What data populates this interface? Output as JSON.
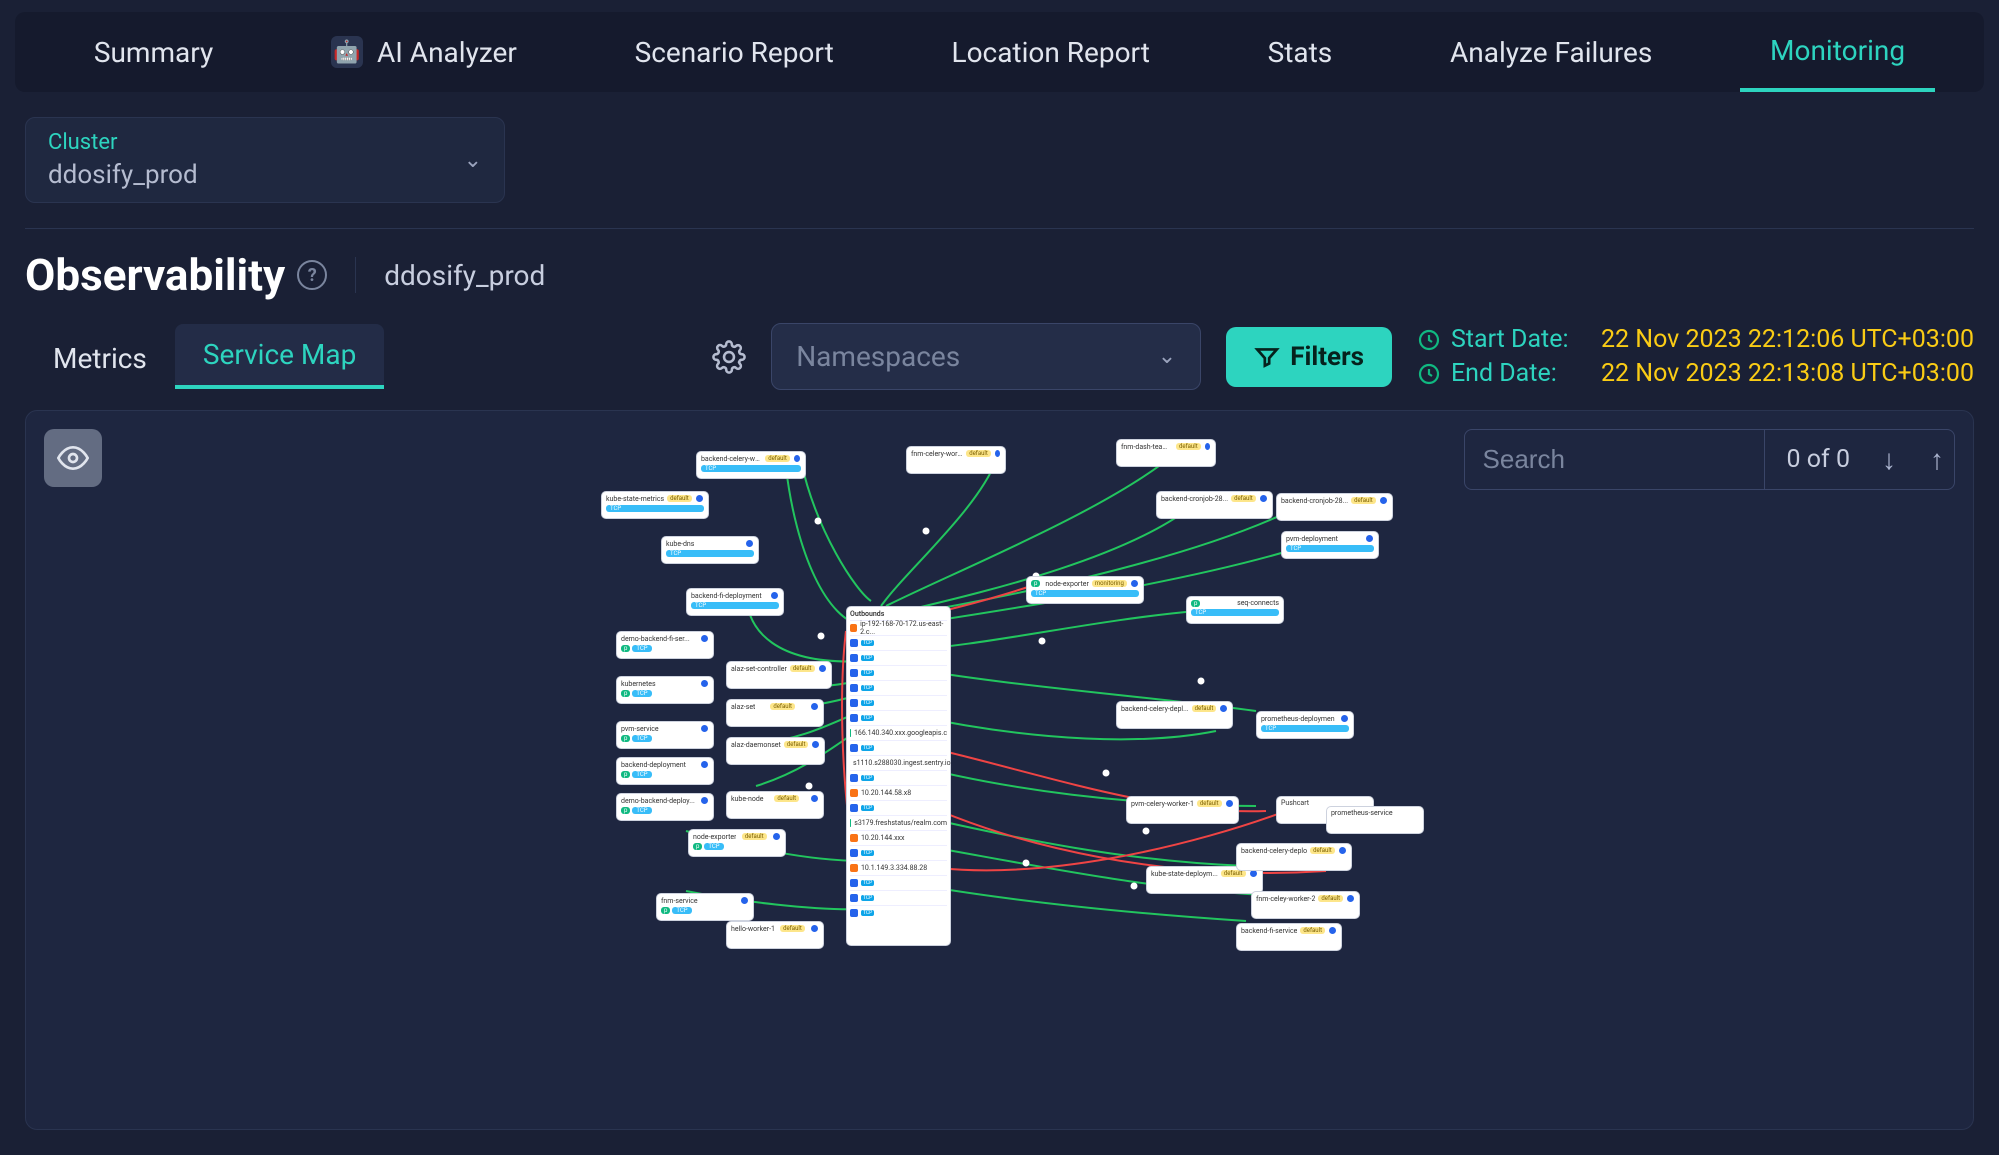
{
  "nav": {
    "tabs": [
      {
        "id": "summary",
        "label": "Summary"
      },
      {
        "id": "ai",
        "label": "AI Analyzer"
      },
      {
        "id": "scenario",
        "label": "Scenario Report"
      },
      {
        "id": "location",
        "label": "Location Report"
      },
      {
        "id": "stats",
        "label": "Stats"
      },
      {
        "id": "failures",
        "label": "Analyze Failures"
      },
      {
        "id": "monitoring",
        "label": "Monitoring"
      }
    ],
    "active_tab": "monitoring"
  },
  "cluster_selector": {
    "label": "Cluster",
    "value": "ddosify_prod"
  },
  "page": {
    "title": "Observability",
    "cluster": "ddosify_prod"
  },
  "sub_tabs": {
    "items": [
      "Metrics",
      "Service Map"
    ],
    "active": 1
  },
  "namespace_select": {
    "placeholder": "Namespaces"
  },
  "filters_btn": "Filters",
  "dates": {
    "start_label": "Start Date:",
    "start_value": "22 Nov 2023 22:12:06 UTC+03:00",
    "end_label": "End Date:",
    "end_value": "22 Nov 2023 22:13:08 UTC+03:00"
  },
  "search": {
    "placeholder": "Search",
    "count": "0 of 0"
  },
  "colors": {
    "accent": "#2dd4bf",
    "warn": "#facc15",
    "bg": "#1a2035",
    "edge_ok": "#22c55e",
    "edge_err": "#ef4444"
  },
  "graph": {
    "big_node": {
      "header": "Outbounds",
      "rows_partial": [
        "ip-192-168-70-172.us-east-2.c...",
        "TCP",
        "TCP",
        "TCP",
        "TCP",
        "TCP",
        "TCP",
        "166.140.340.xxx.googleapis.c",
        "TCP",
        "s1110.s288030.ingest.sentry.io",
        "TCP",
        "10.20.144.58.x8",
        "TCP",
        "s3179.freshstatus/realm.com",
        "10.20.144.xxx",
        "TCP",
        "10.1.149.3.334.88.28",
        "TCP",
        "TCP",
        "TCP"
      ]
    },
    "nodes_left_col1": [
      "kube-state-metrics",
      "kube-dns",
      "backend-fi-deployment"
    ],
    "nodes_left_col2": [
      "demo-backend-fi-ser...",
      "kubernetes",
      "pvm-service",
      "backend-deployment",
      "demo-backend-deploy...",
      "fnm-service",
      "node-exporter"
    ],
    "nodes_left_col3": [
      "backend-celery-work...",
      "alaz-set-controller",
      "alaz-set",
      "alaz-daemonset",
      "kube-node",
      "hello-worker-1"
    ],
    "nodes_top": [
      "fnm-celery-worker-de...",
      "fnm-dash-team-depl..."
    ],
    "nodes_right": [
      "backend-cronjob-28...",
      "backend-cronjob-28...",
      "pvm-deployment",
      "node-exporter",
      "seq-connects",
      "backend-celery-depl...",
      "prometheus-deploymen",
      "pvm-celery-worker-1",
      "Pushcart",
      "prometheus-service",
      "kube-state-deploym...",
      "backend-celery-deplo",
      "fnm-celey-worker-2",
      "backend-fi-service"
    ]
  }
}
